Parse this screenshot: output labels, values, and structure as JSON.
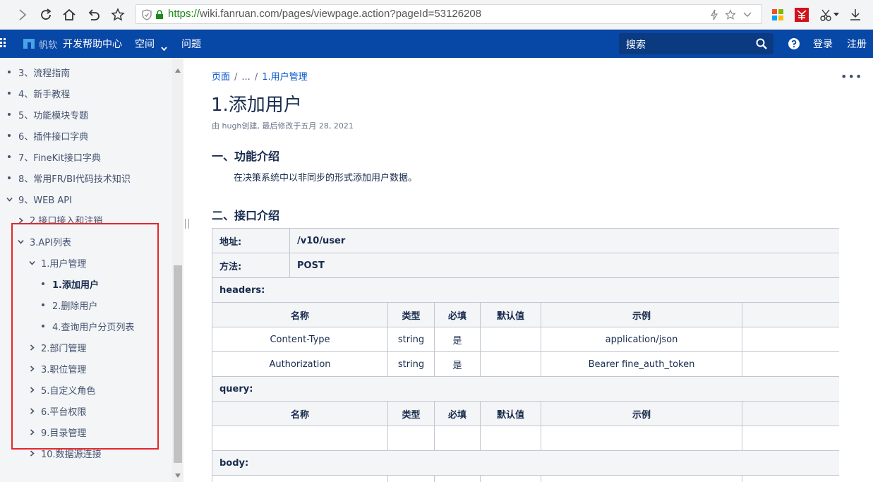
{
  "browser": {
    "url_scheme": "https://",
    "url_rest": "wiki.fanruan.com/pages/viewpage.action?pageId=53126208"
  },
  "header": {
    "brand": "帆软",
    "site_title": "开发帮助中心",
    "space_menu": "空间",
    "issues": "问题",
    "search_label": "搜索",
    "login": "登录",
    "register": "注册",
    "color_bg": "#0747a6"
  },
  "sidebar": {
    "items": [
      {
        "label": "3、流程指南"
      },
      {
        "label": "4、新手教程"
      },
      {
        "label": "5、功能模块专题"
      },
      {
        "label": "6、插件接口字典"
      },
      {
        "label": "7、FineKit接口字典"
      },
      {
        "label": "8、常用FR/BI代码技术知识"
      },
      {
        "label": "9、WEB API"
      },
      {
        "label": "2.接口接入和注销"
      },
      {
        "label": "3.API列表"
      },
      {
        "label": "1.用户管理"
      },
      {
        "label": "1.添加用户"
      },
      {
        "label": "2.删除用户"
      },
      {
        "label": "4.查询用户分页列表"
      },
      {
        "label": "2.部门管理"
      },
      {
        "label": "3.职位管理"
      },
      {
        "label": "5.自定义角色"
      },
      {
        "label": "6.平台权限"
      },
      {
        "label": "9.目录管理"
      },
      {
        "label": "10.数据源连接"
      }
    ],
    "highlight_color": "#e5262b"
  },
  "page": {
    "breadcrumb": [
      "页面",
      "...",
      "1.用户管理"
    ],
    "breadcrumb_sep": "/",
    "more": "•••",
    "title": "1.添加用户",
    "meta": "由 hugh创建, 最后修改于五月 28, 2021",
    "section1_title": "一、功能介绍",
    "section1_text": "在决策系统中以非同步的形式添加用户数据。",
    "section2_title": "二、接口介绍"
  },
  "api_table": {
    "address_label": "地址:",
    "address_value": "/v10/user",
    "method_label": "方法:",
    "method_value": "POST",
    "headers_label": "headers:",
    "query_label": "query:",
    "body_label": "body:",
    "columns": [
      "名称",
      "类型",
      "必填",
      "默认值",
      "示例"
    ],
    "header_rows": [
      {
        "name": "Content-Type",
        "type": "string",
        "required": "是",
        "default": "",
        "example": "application/json"
      },
      {
        "name": "Authorization",
        "type": "string",
        "required": "是",
        "default": "",
        "example": "Bearer fine_auth_token"
      }
    ]
  }
}
